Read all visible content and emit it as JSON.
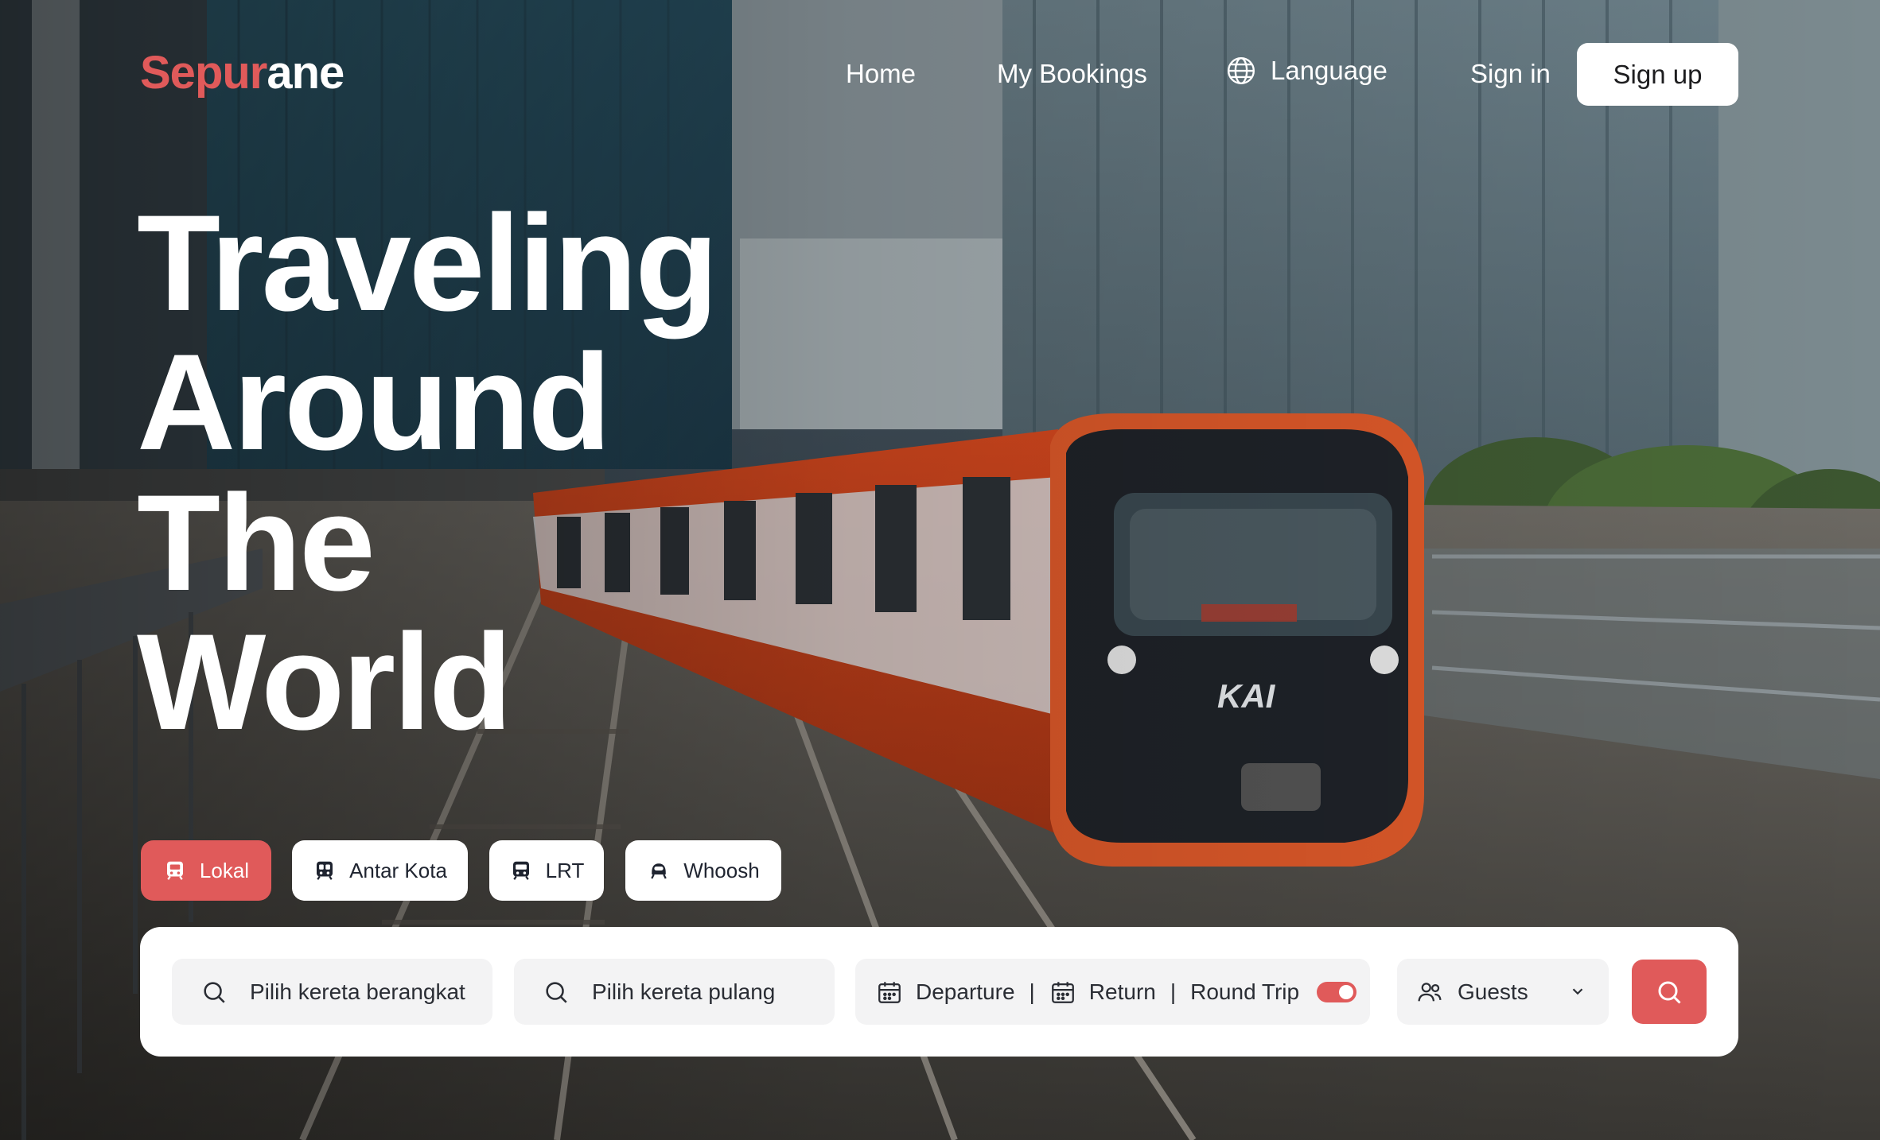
{
  "brand": {
    "logo_accent": "Sepur",
    "logo_rest": "ane",
    "accent_color": "#e05a5a"
  },
  "nav": {
    "home": "Home",
    "bookings": "My Bookings",
    "language": "Language",
    "sign_in": "Sign in",
    "sign_up": "Sign up"
  },
  "hero": {
    "headline_lines": [
      "Traveling",
      "Around",
      "The",
      "World"
    ],
    "background": "train-on-elevated-track-photo",
    "train_marking": "KAI"
  },
  "tabs": [
    {
      "label": "Lokal",
      "icon": "train-front-icon",
      "active": true
    },
    {
      "label": "Antar Kota",
      "icon": "train-icon",
      "active": false
    },
    {
      "label": "LRT",
      "icon": "lrt-icon",
      "active": false
    },
    {
      "label": "Whoosh",
      "icon": "high-speed-train-icon",
      "active": false
    }
  ],
  "search": {
    "from_placeholder": "Pilih kereta berangkat",
    "to_placeholder": "Pilih kereta pulang",
    "departure": "Departure",
    "return": "Return",
    "round_trip": "Round Trip",
    "round_trip_on": true,
    "guests": "Guests",
    "separator": "|"
  }
}
